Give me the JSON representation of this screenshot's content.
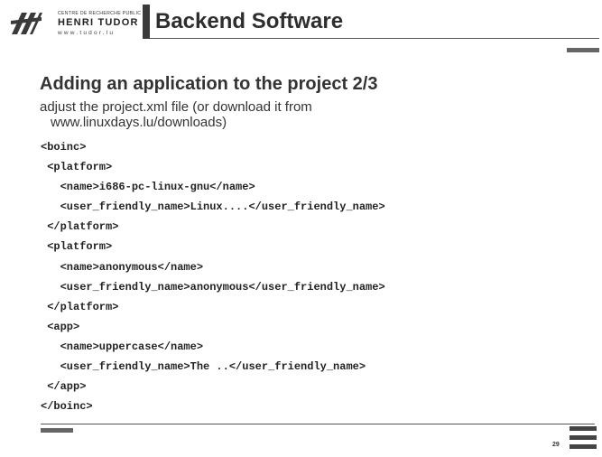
{
  "header": {
    "logo_small": "CENTRE DE RECHERCHE PUBLIC",
    "logo_name": "HENRI TUDOR",
    "logo_url": "www.tudor.lu",
    "title": "Backend Software"
  },
  "slide": {
    "subtitle": "Adding an application to the project 2/3",
    "intro_line1": "adjust the project.xml file (or download it from",
    "intro_line2": "www.linuxdays.lu/downloads)",
    "code_lines": [
      "<boinc>",
      " <platform>",
      "   <name>i686-pc-linux-gnu</name>",
      "   <user_friendly_name>Linux....</user_friendly_name>",
      " </platform>",
      " <platform>",
      "   <name>anonymous</name>",
      "   <user_friendly_name>anonymous</user_friendly_name>",
      " </platform>",
      " <app>",
      "   <name>uppercase</name>",
      "   <user_friendly_name>The ..</user_friendly_name>",
      " </app>",
      "</boinc>"
    ]
  },
  "footer": {
    "page_number": "29"
  },
  "colors": {
    "accent": "#3a3a3a",
    "text": "#2e2e2e"
  }
}
